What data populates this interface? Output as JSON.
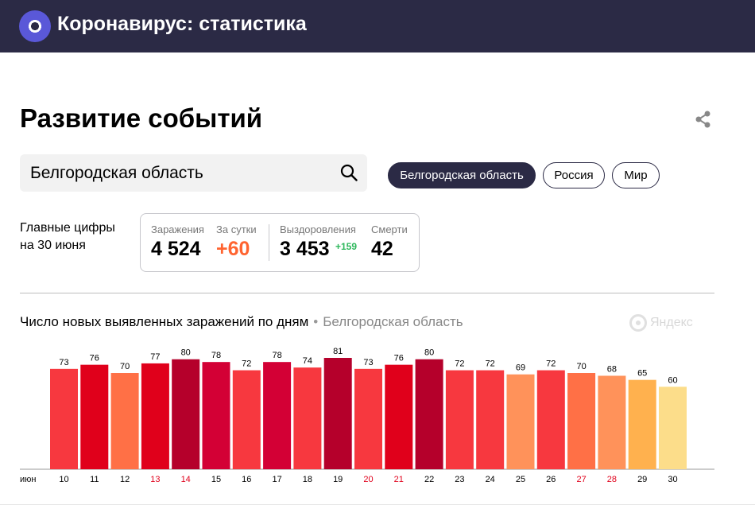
{
  "header": {
    "app_title": "Коронавирус: статистика",
    "logo_icon": "coronavirus-logo-icon",
    "background": "#2b2a45"
  },
  "page": {
    "title": "Развитие событий",
    "share_icon": "share-icon"
  },
  "search": {
    "value": "Белгородская область",
    "icon": "search-icon"
  },
  "region_chips": [
    {
      "label": "Белгородская область",
      "active": true
    },
    {
      "label": "Россия",
      "active": false
    },
    {
      "label": "Мир",
      "active": false
    }
  ],
  "main_figures": {
    "label_line1": "Главные цифры",
    "label_line2": "на 30 июня",
    "infections": {
      "label": "Заражения",
      "value": "4 524"
    },
    "per_day": {
      "label": "За сутки",
      "value": "+60"
    },
    "recoveries": {
      "label": "Выздоровления",
      "value": "3 453",
      "delta": "+159"
    },
    "deaths": {
      "label": "Смерти",
      "value": "42"
    }
  },
  "chart_section": {
    "heading": "Число новых выявленных заражений по дням",
    "region": "Белгородская область",
    "watermark": "Яндекс"
  },
  "colors": {
    "accent_dark": "#2b2a45",
    "orange": "#ff6430",
    "green": "#2eb85c",
    "weekend_red": "#e0001b"
  },
  "chart_data": {
    "type": "bar",
    "x_unit_label": "июн",
    "categories": [
      "10",
      "11",
      "12",
      "13",
      "14",
      "15",
      "16",
      "17",
      "18",
      "19",
      "20",
      "21",
      "22",
      "23",
      "24",
      "25",
      "26",
      "27",
      "28",
      "29",
      "30"
    ],
    "values": [
      73,
      76,
      70,
      77,
      80,
      78,
      72,
      78,
      74,
      81,
      73,
      76,
      80,
      72,
      72,
      69,
      72,
      70,
      68,
      65,
      60
    ],
    "weekend_categories": [
      "13",
      "14",
      "20",
      "21",
      "27",
      "28"
    ],
    "bar_colors": [
      "#f7383f",
      "#e0001b",
      "#ff7046",
      "#e0001b",
      "#b5002b",
      "#d30035",
      "#f7383f",
      "#d30035",
      "#f7383f",
      "#b5002b",
      "#f7383f",
      "#e0001b",
      "#b5002b",
      "#f7383f",
      "#f7383f",
      "#ff925a",
      "#f7383f",
      "#ff7046",
      "#ff925a",
      "#ffb14e",
      "#fcdd8a"
    ],
    "ylim": [
      0,
      81
    ]
  }
}
